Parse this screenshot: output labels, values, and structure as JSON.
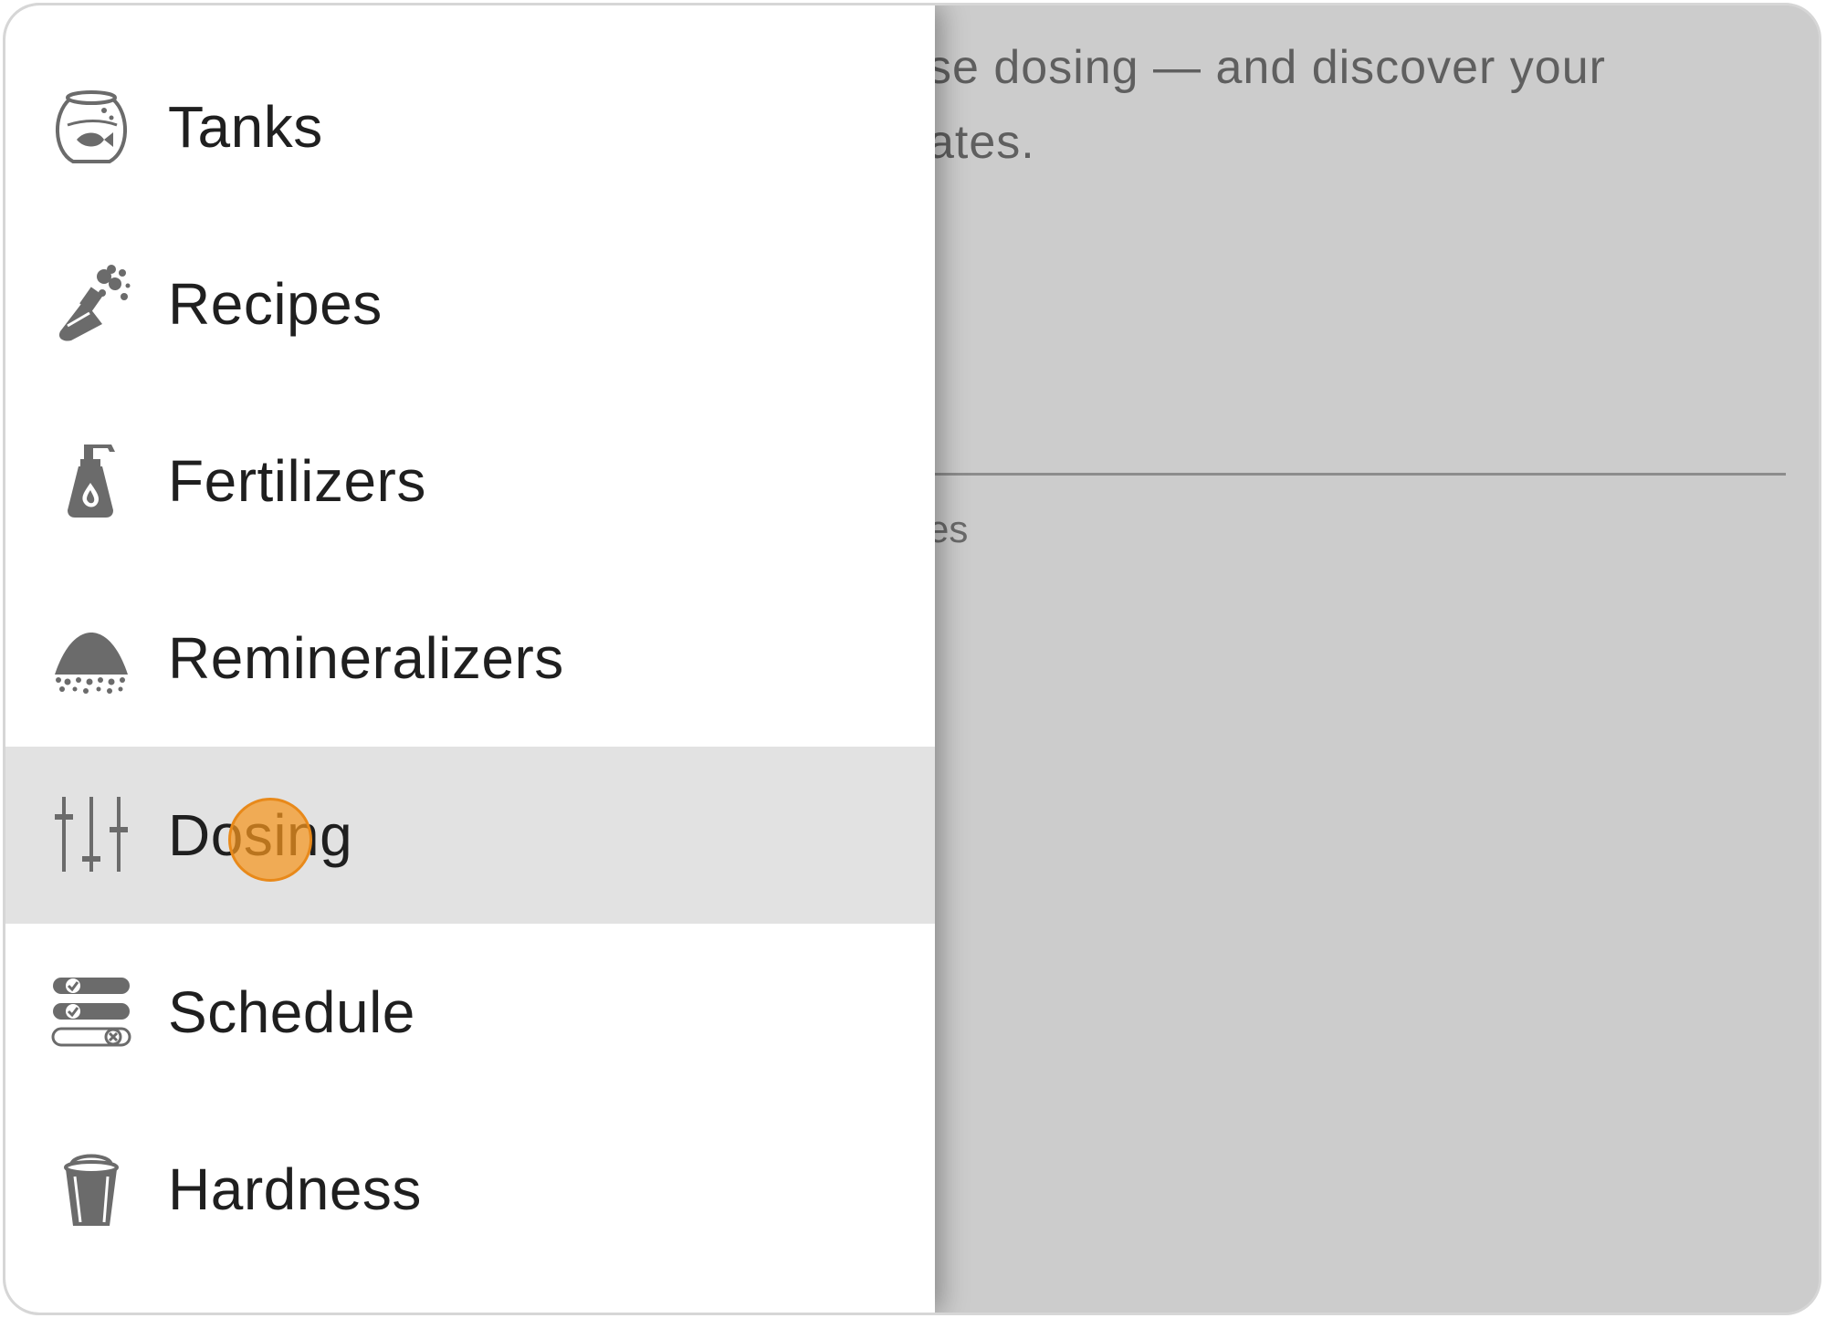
{
  "background": {
    "line1": "se dosing — and discover your",
    "line2": "ates.",
    "small": "es"
  },
  "drawer": {
    "items": [
      {
        "label": "Tanks",
        "icon": "fishbowl-icon"
      },
      {
        "label": "Recipes",
        "icon": "flask-icon"
      },
      {
        "label": "Fertilizers",
        "icon": "spray-bottle-icon"
      },
      {
        "label": "Remineralizers",
        "icon": "powder-pile-icon"
      },
      {
        "label": "Dosing",
        "icon": "sliders-icon",
        "selected": true
      },
      {
        "label": "Schedule",
        "icon": "checklist-icon"
      },
      {
        "label": "Hardness",
        "icon": "bucket-icon"
      }
    ]
  },
  "colors": {
    "icon": "#6b6b6b",
    "selected_bg": "#e2e2e2",
    "scrim": "#cccccc",
    "tap_indicator": "#f5961e"
  }
}
